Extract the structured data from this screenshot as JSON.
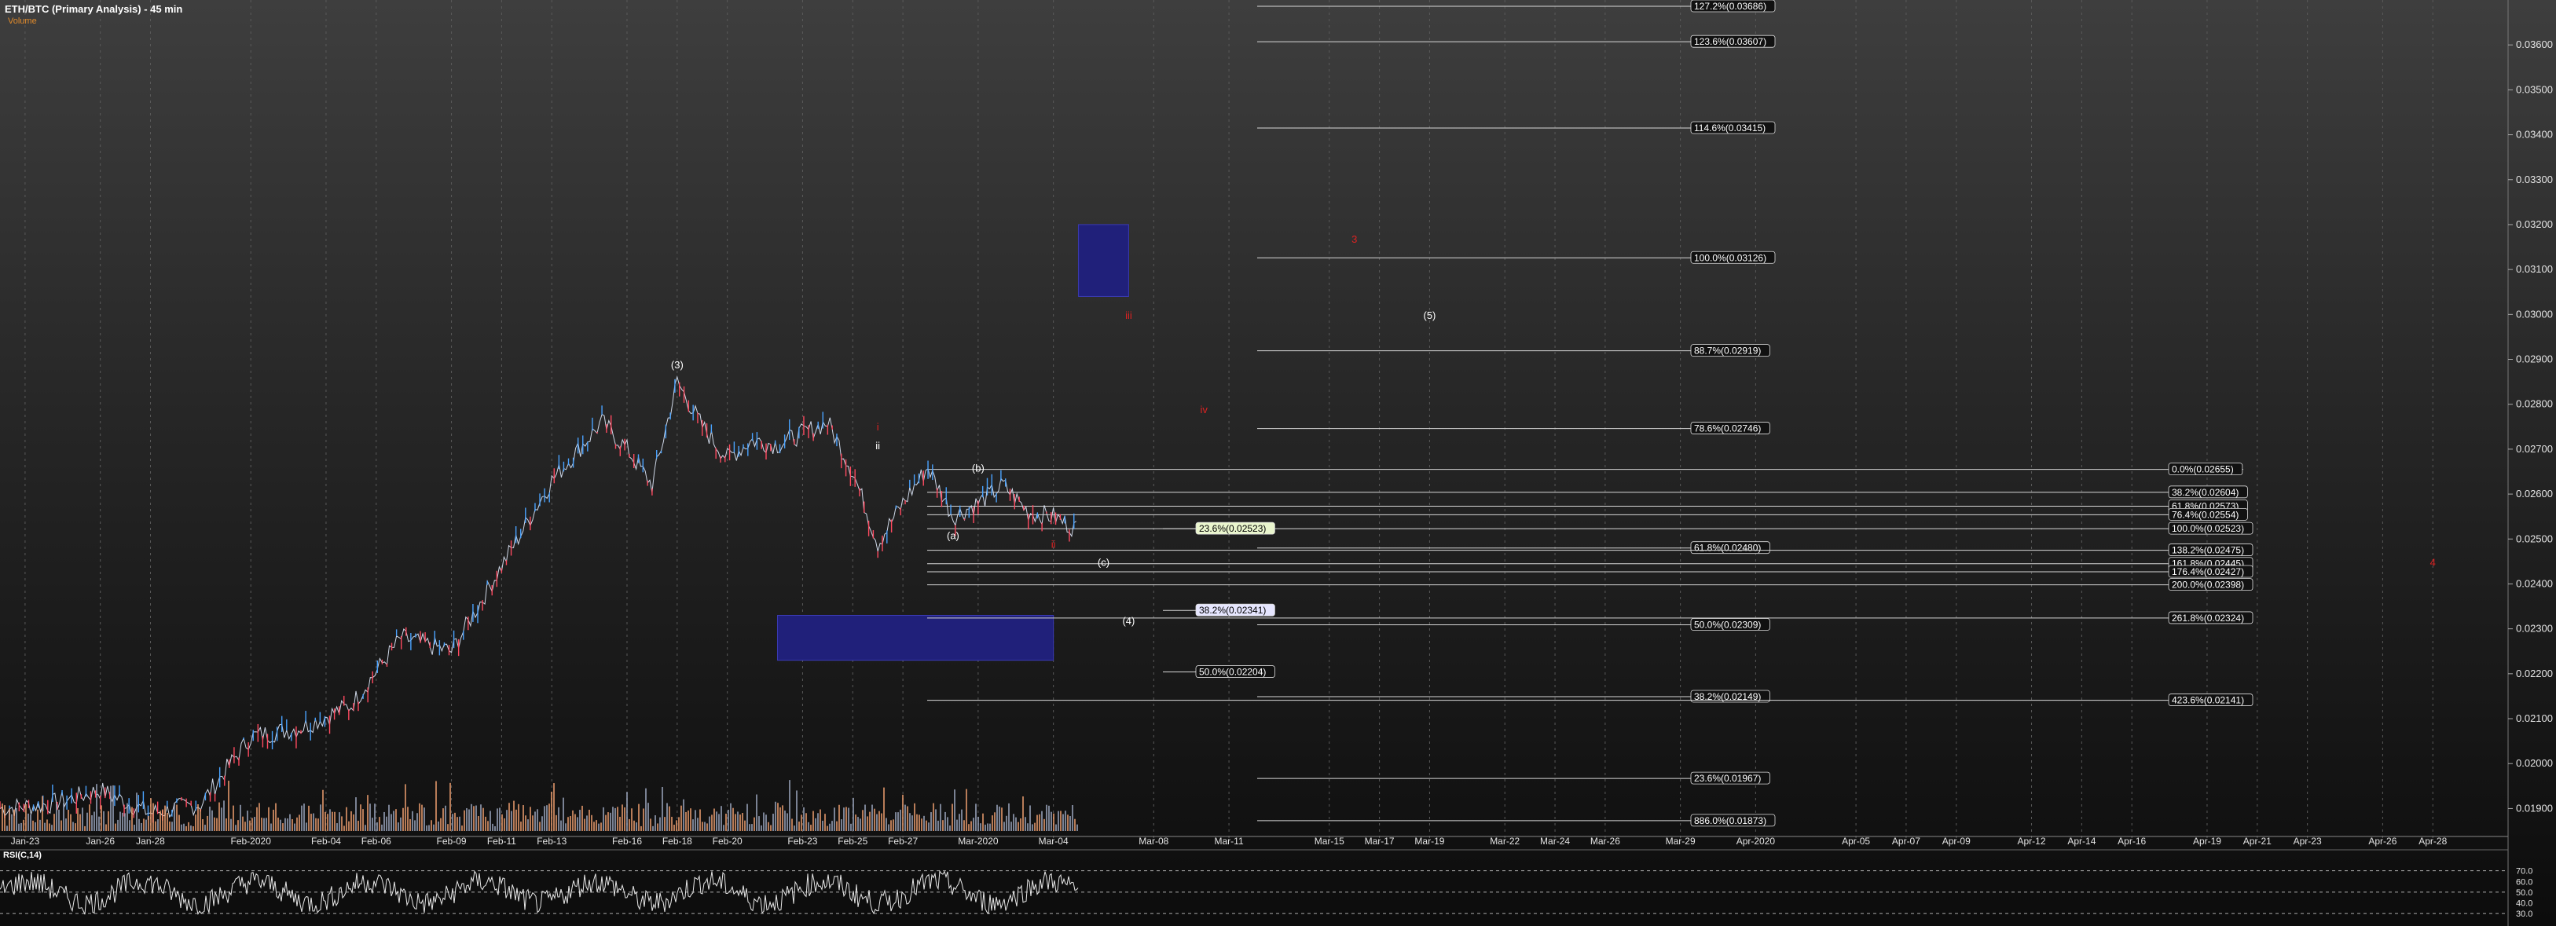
{
  "header": {
    "title": "ETH/BTC (Primary Analysis) - 45 min",
    "volume_label": "Volume",
    "rsi_label": "RSI(C,14)"
  },
  "colors": {
    "price_up": "#4aa3ff",
    "price_down": "#ff4a60",
    "fib": "#d8d8d8",
    "zone": "#20207a",
    "wave_red": "#dd2222",
    "volume": "#f0a070",
    "rsi_line": "#e8e8e8"
  },
  "chart_data": {
    "type": "line",
    "title": "ETH/BTC (Primary Analysis) - 45 min",
    "ylim": [
      0.0185,
      0.037
    ],
    "x_labels": [
      "Jan-23",
      "Jan-26",
      "Jan-28",
      "Feb-2020",
      "Feb-04",
      "Feb-06",
      "Feb-09",
      "Feb-11",
      "Feb-13",
      "Feb-16",
      "Feb-18",
      "Feb-20",
      "Feb-23",
      "Feb-25",
      "Feb-27",
      "Mar-2020",
      "Mar-04",
      "Mar-08",
      "Mar-11",
      "Mar-15",
      "Mar-17",
      "Mar-19",
      "Mar-22",
      "Mar-24",
      "Mar-26",
      "Mar-29",
      "Apr-2020",
      "Apr-05",
      "Apr-07",
      "Apr-09",
      "Apr-12",
      "Apr-14",
      "Apr-16",
      "Apr-19",
      "Apr-21",
      "Apr-23",
      "Apr-26",
      "Apr-28"
    ],
    "y_ticks": [
      "0.03600",
      "0.03500",
      "0.03400",
      "0.03300",
      "0.03200",
      "0.03100",
      "0.03000",
      "0.02900",
      "0.02800",
      "0.02700",
      "0.02600",
      "0.02500",
      "0.02400",
      "0.02300",
      "0.02200",
      "0.02100",
      "0.02000",
      "0.01900"
    ],
    "price_series": {
      "name": "ETH/BTC",
      "x": [
        "Jan-22",
        "Jan-24",
        "Jan-26",
        "Jan-28",
        "Jan-30",
        "Feb-01",
        "Feb-03",
        "Feb-05",
        "Feb-07",
        "Feb-09",
        "Feb-11",
        "Feb-13",
        "Feb-15",
        "Feb-16",
        "Feb-17",
        "Feb-18",
        "Feb-19",
        "Feb-20",
        "Feb-21",
        "Feb-22",
        "Feb-24",
        "Feb-25",
        "Feb-26",
        "Feb-27",
        "Feb-28",
        "Feb-29",
        "Mar-01",
        "Mar-02",
        "Mar-03",
        "Mar-04",
        "Mar-05"
      ],
      "y": [
        0.019,
        0.0191,
        0.0194,
        0.0189,
        0.0191,
        0.0206,
        0.0208,
        0.0213,
        0.0228,
        0.0225,
        0.0244,
        0.0263,
        0.0276,
        0.027,
        0.0262,
        0.0285,
        0.0275,
        0.0268,
        0.0272,
        0.0271,
        0.0276,
        0.0265,
        0.0249,
        0.0258,
        0.0266,
        0.0255,
        0.0258,
        0.0262,
        0.0256,
        0.0255,
        0.0252
      ]
    },
    "fib_levels": [
      {
        "label": "127.2%(0.03686)",
        "value": 0.03686
      },
      {
        "label": "123.6%(0.03607)",
        "value": 0.03607
      },
      {
        "label": "114.6%(0.03415)",
        "value": 0.03415
      },
      {
        "label": "100.0%(0.03126)",
        "value": 0.03126
      },
      {
        "label": "88.7%(0.02919)",
        "value": 0.02919
      },
      {
        "label": "78.6%(0.02746)",
        "value": 0.02746
      },
      {
        "label": "61.8%(0.02480)",
        "value": 0.0248
      },
      {
        "label": "50.0%(0.02309)",
        "value": 0.02309
      },
      {
        "label": "38.2%(0.02149)",
        "value": 0.02149
      },
      {
        "label": "23.6%(0.01967)",
        "value": 0.01967
      },
      {
        "label": "886.0%(0.01873)",
        "value": 0.01873
      }
    ],
    "fib_levels_right": [
      {
        "label": "0.0%(0.02655)",
        "value": 0.02655
      },
      {
        "label": "38.2%(0.02604)",
        "value": 0.02604
      },
      {
        "label": "61.8%(0.02573)",
        "value": 0.02573
      },
      {
        "label": "76.4%(0.02554)",
        "value": 0.02554
      },
      {
        "label": "100.0%(0.02523)",
        "value": 0.02523
      },
      {
        "label": "138.2%(0.02475)",
        "value": 0.02475
      },
      {
        "label": "161.8%(0.02445)",
        "value": 0.02445
      },
      {
        "label": "176.4%(0.02427)",
        "value": 0.02427
      },
      {
        "label": "200.0%(0.02398)",
        "value": 0.02398
      },
      {
        "label": "261.8%(0.02324)",
        "value": 0.02324
      },
      {
        "label": "423.6%(0.02141)",
        "value": 0.02141
      }
    ],
    "fib_mid": [
      {
        "label": "23.6%(0.02523)",
        "value": 0.02523
      },
      {
        "label": "38.2%(0.02341)",
        "value": 0.02341
      },
      {
        "label": "50.0%(0.02204)",
        "value": 0.02204
      }
    ],
    "zones": [
      {
        "x0": "Mar-05",
        "x1": "Mar-07",
        "y0": 0.0304,
        "y1": 0.032
      },
      {
        "x0": "Feb-22",
        "x1": "Mar-04",
        "y0": 0.0223,
        "y1": 0.0233
      }
    ],
    "wave_labels": [
      {
        "text": "(3)",
        "x": "Feb-18",
        "y": 0.0288,
        "color": "#ffffff"
      },
      {
        "text": "(5)",
        "x": "Mar-19",
        "y": 0.0299,
        "color": "#ffffff"
      },
      {
        "text": "(4)",
        "x": "Mar-07",
        "y": 0.0231,
        "color": "#ffffff"
      },
      {
        "text": "(b)",
        "x": "Mar-01",
        "y": 0.0265,
        "color": "#ffffff"
      },
      {
        "text": "(a)",
        "x": "Feb-29",
        "y": 0.025,
        "color": "#ffffff"
      },
      {
        "text": "(c)",
        "x": "Mar-06",
        "y": 0.0244,
        "color": "#ffffff"
      },
      {
        "text": "ii",
        "x": "Feb-26",
        "y": 0.027,
        "color": "#ffffff"
      },
      {
        "text": "i",
        "x": "Feb-26",
        "y": 0.02742,
        "color": "#dd2222"
      },
      {
        "text": "iii",
        "x": "Mar-07",
        "y": 0.0299,
        "color": "#dd2222"
      },
      {
        "text": "iv",
        "x": "Mar-10",
        "y": 0.0278,
        "color": "#dd2222"
      },
      {
        "text": "ii",
        "x": "Mar-04",
        "y": 0.0248,
        "color": "#dd2222"
      },
      {
        "text": "3",
        "x": "Mar-16",
        "y": 0.0316,
        "color": "#dd2222"
      },
      {
        "text": "4",
        "x": "Apr-28",
        "y": 0.0244,
        "color": "#dd2222"
      }
    ],
    "rsi": {
      "name": "RSI(C,14)",
      "ticks": [
        "70.0",
        "60.0",
        "50.0",
        "40.0",
        "30.0"
      ],
      "ylim": [
        25,
        80
      ]
    }
  }
}
